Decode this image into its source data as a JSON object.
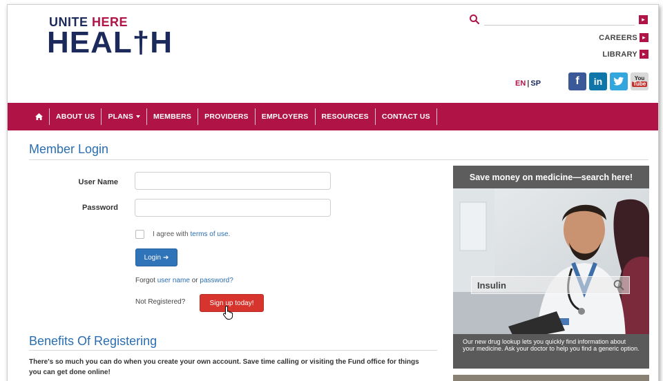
{
  "header": {
    "logo_top_unite": "UNITE",
    "logo_top_here": "HERE",
    "logo_big": "HEAL†H",
    "search_placeholder": "",
    "go_glyph": "▸",
    "links": [
      {
        "label": "CAREERS"
      },
      {
        "label": "LIBRARY"
      }
    ],
    "lang_en": "EN",
    "lang_sep": "|",
    "lang_sp": "SP",
    "social": {
      "facebook": "f",
      "linkedin": "in",
      "twitter": "❧",
      "youtube_top": "You",
      "youtube_bottom": "Tube"
    }
  },
  "nav": {
    "items": [
      "ABOUT US",
      "PLANS",
      "MEMBERS",
      "PROVIDERS",
      "EMPLOYERS",
      "RESOURCES",
      "CONTACT US"
    ]
  },
  "login": {
    "title": "Member Login",
    "username_label": "User Name",
    "password_label": "Password",
    "agree_text": "I agree with ",
    "terms_link": "terms of use.",
    "login_button": "Login",
    "login_icon": "➔",
    "forgot_prefix": "Forgot ",
    "forgot_user": "user name",
    "forgot_or": " or ",
    "forgot_pass": "password?",
    "not_registered": "Not Registered?",
    "signup_button": "Sign up today!"
  },
  "benefits": {
    "title": "Benefits Of Registering",
    "text": "There's so much you can do when you create your own account. Save time calling or visiting the Fund office for things you can get done online!"
  },
  "promo": {
    "heading": "Save money on medicine—search here!",
    "search_value": "Insulin",
    "caption": "Our new drug lookup lets you quickly find information about your medicine. Ask your doctor to help you find a generic option."
  },
  "colors": {
    "brand_red": "#b01446",
    "brand_navy": "#1b2a5a",
    "link_blue": "#2a6eb0",
    "signup_red": "#d6342c"
  }
}
